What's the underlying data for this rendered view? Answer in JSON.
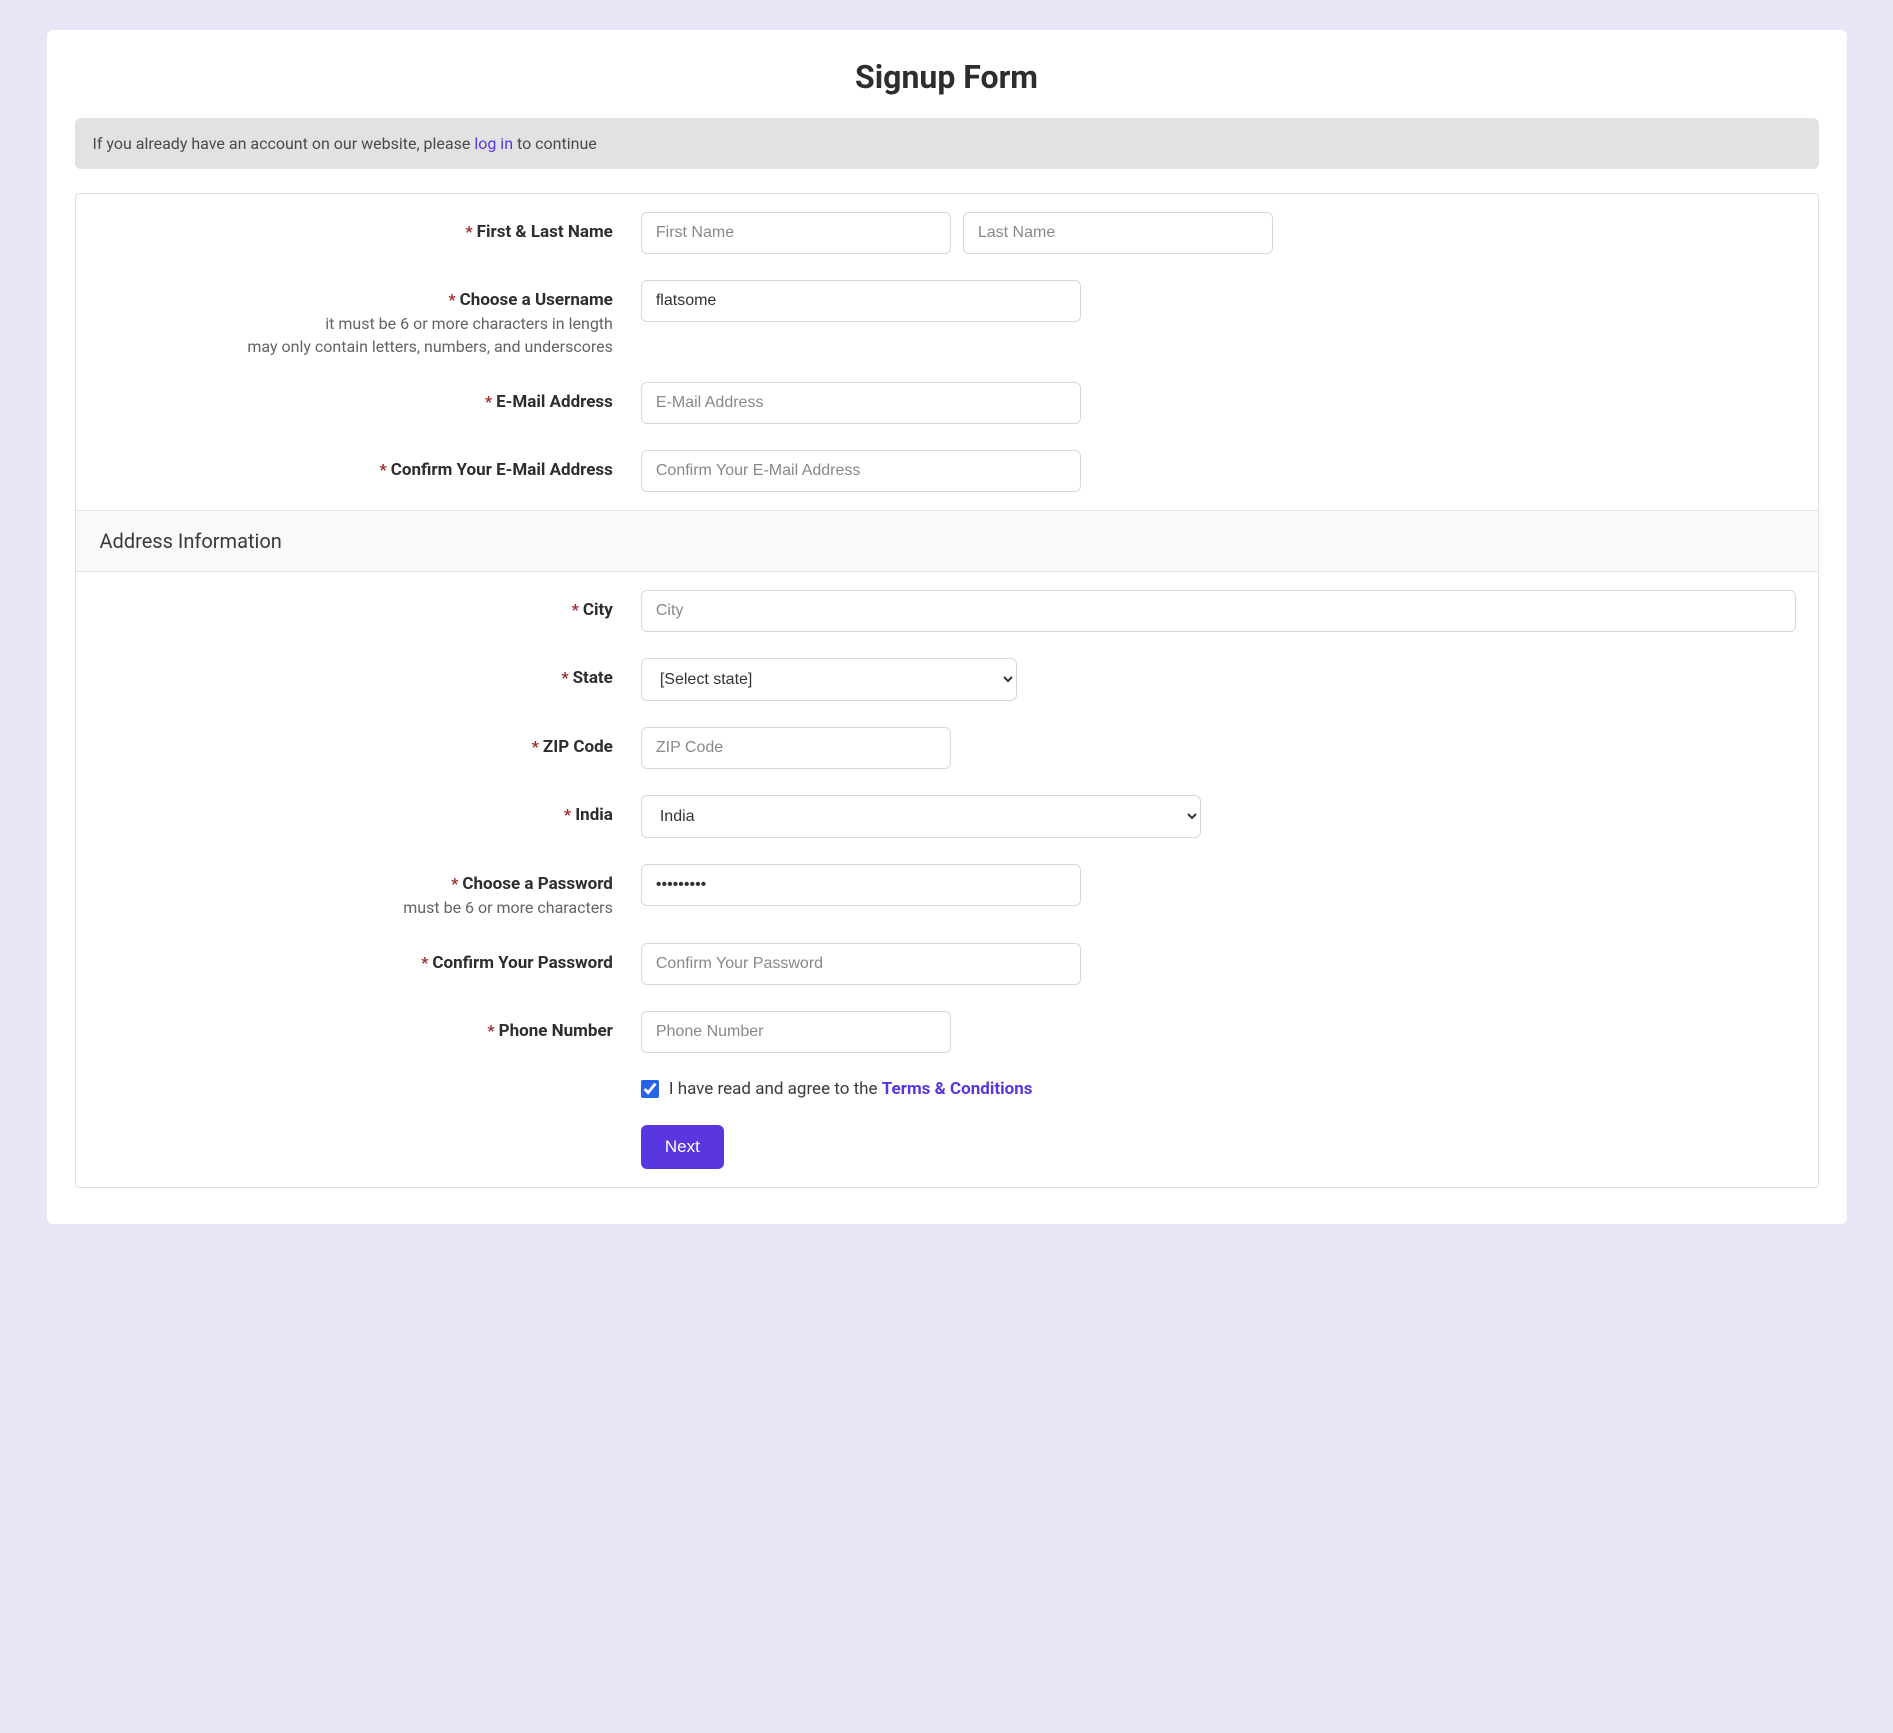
{
  "page": {
    "title": "Signup Form"
  },
  "banner": {
    "text_before": "If you already have an account on our website, please ",
    "link_text": "log in",
    "text_after": " to continue"
  },
  "fields": {
    "name": {
      "label": "First & Last Name",
      "first_placeholder": "First Name",
      "last_placeholder": "Last Name",
      "first_value": "",
      "last_value": ""
    },
    "username": {
      "label": "Choose a Username",
      "hint1": "it must be 6 or more characters in length",
      "hint2": "may only contain letters, numbers, and underscores",
      "value": "flatsome"
    },
    "email": {
      "label": "E-Mail Address",
      "placeholder": "E-Mail Address",
      "value": ""
    },
    "email_confirm": {
      "label": "Confirm Your E-Mail Address",
      "placeholder": "Confirm Your E-Mail Address",
      "value": ""
    },
    "address_section": "Address Information",
    "city": {
      "label": "City",
      "placeholder": "City",
      "value": ""
    },
    "state": {
      "label": "State",
      "selected": "[Select state]"
    },
    "zip": {
      "label": "ZIP Code",
      "placeholder": "ZIP Code",
      "value": ""
    },
    "country": {
      "label": "India",
      "selected": "India"
    },
    "password": {
      "label": "Choose a Password",
      "hint": "must be 6 or more characters",
      "value": "•••••••••"
    },
    "password_confirm": {
      "label": "Confirm Your Password",
      "placeholder": "Confirm Your Password",
      "value": ""
    },
    "phone": {
      "label": "Phone Number",
      "placeholder": "Phone Number",
      "value": ""
    },
    "terms": {
      "label_before": "I have read and agree to the ",
      "link": "Terms & Conditions",
      "checked": true
    },
    "submit": {
      "label": "Next"
    }
  },
  "required_marker": "*"
}
